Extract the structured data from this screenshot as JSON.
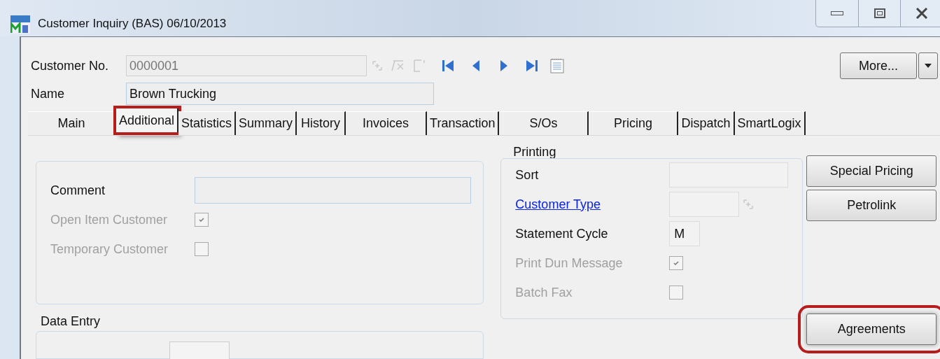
{
  "window": {
    "title": "Customer Inquiry (BAS) 06/10/2013"
  },
  "header": {
    "customer_no": {
      "label": "Customer No.",
      "value": "0000001",
      "disabled": true
    },
    "name": {
      "label": "Name",
      "value": "Brown Trucking"
    },
    "more_button": "More..."
  },
  "tabs": [
    {
      "label": "Main",
      "selected": false,
      "highlighted": false
    },
    {
      "label": "Additional",
      "selected": true,
      "highlighted": true
    },
    {
      "label": "Statistics",
      "selected": false,
      "highlighted": false
    },
    {
      "label": "Summary",
      "selected": false,
      "highlighted": false
    },
    {
      "label": "History",
      "selected": false,
      "highlighted": false
    },
    {
      "label": "Invoices",
      "selected": false,
      "highlighted": false
    },
    {
      "label": "Transaction",
      "selected": false,
      "highlighted": false
    },
    {
      "label": "S/Os",
      "selected": false,
      "highlighted": false
    },
    {
      "label": "Pricing",
      "selected": false,
      "highlighted": false
    },
    {
      "label": "Dispatch",
      "selected": false,
      "highlighted": false
    },
    {
      "label": "SmartLogix",
      "selected": false,
      "highlighted": false
    }
  ],
  "general": {
    "fields": [
      {
        "kind": "text",
        "label": "Comment",
        "disabled": false
      },
      {
        "kind": "checkbox",
        "label": "Open Item Customer",
        "checked": true,
        "disabled": true
      },
      {
        "kind": "checkbox",
        "label": "Temporary Customer",
        "checked": false,
        "disabled": true
      }
    ]
  },
  "data_entry": {
    "title": "Data Entry"
  },
  "printing": {
    "title": "Printing",
    "fields": [
      {
        "kind": "text",
        "label": "Sort",
        "link": false
      },
      {
        "kind": "lookup",
        "label": "Customer Type",
        "link": true
      },
      {
        "kind": "short",
        "label": "Statement Cycle",
        "value": "M",
        "link": false
      },
      {
        "kind": "checkbox",
        "label": "Print Dun Message",
        "checked": true,
        "disabled": true
      },
      {
        "kind": "checkbox",
        "label": "Batch Fax",
        "checked": false,
        "disabled": true
      }
    ]
  },
  "side_buttons": [
    {
      "label": "Special Pricing",
      "highlighted": false
    },
    {
      "label": "Petrolink",
      "highlighted": false
    },
    {
      "label": "Agreements",
      "highlighted": true
    }
  ]
}
